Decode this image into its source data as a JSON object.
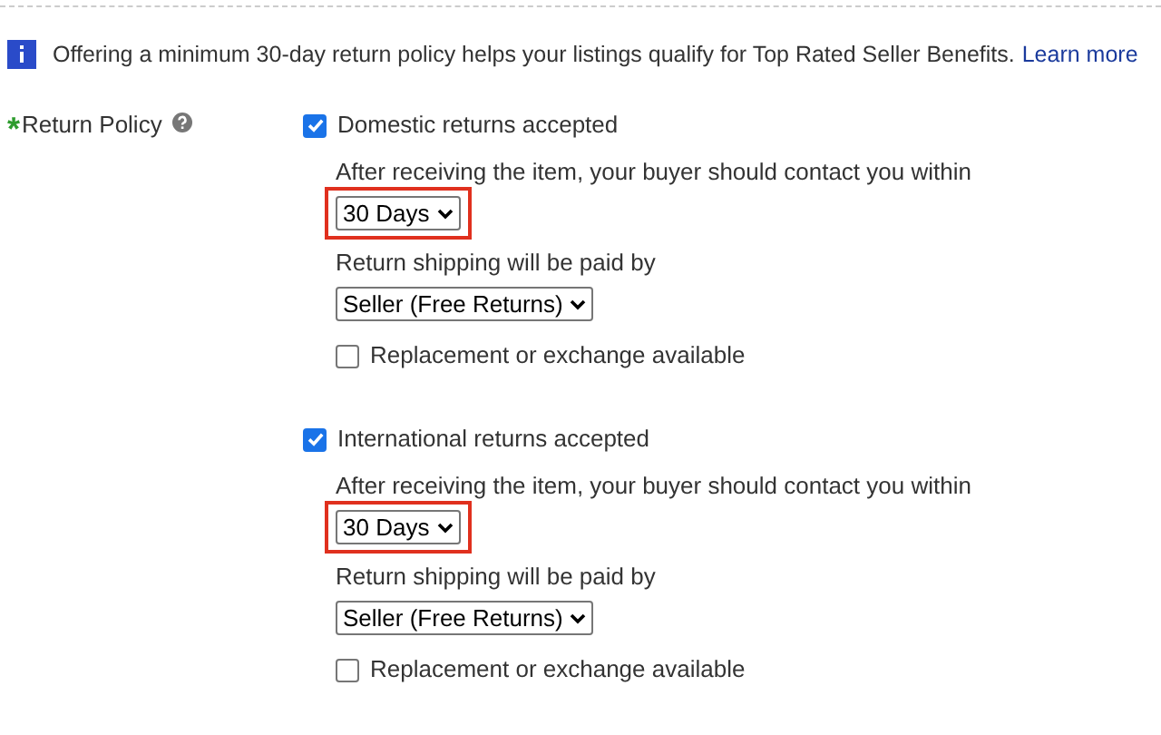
{
  "notice": {
    "text": "Offering a minimum 30-day return policy helps your listings qualify for Top Rated Seller Benefits.",
    "link": "Learn more"
  },
  "field": {
    "label": "Return Policy",
    "required": true,
    "required_mark": "*"
  },
  "sections": [
    {
      "label": "Domestic returns accepted",
      "checked": true,
      "contact_label": "After receiving the item, your buyer should contact you within",
      "period": "30 Days",
      "highlighted": true,
      "shipping_label": "Return shipping will be paid by",
      "payer": "Seller (Free Returns)",
      "replacement": {
        "label": "Replacement or exchange available",
        "checked": false
      }
    },
    {
      "label": "International returns accepted",
      "checked": true,
      "contact_label": "After receiving the item, your buyer should contact you within",
      "period": "30 Days",
      "highlighted": true,
      "shipping_label": "Return shipping will be paid by",
      "payer": "Seller (Free Returns)",
      "replacement": {
        "label": "Replacement or exchange available",
        "checked": false
      }
    }
  ]
}
